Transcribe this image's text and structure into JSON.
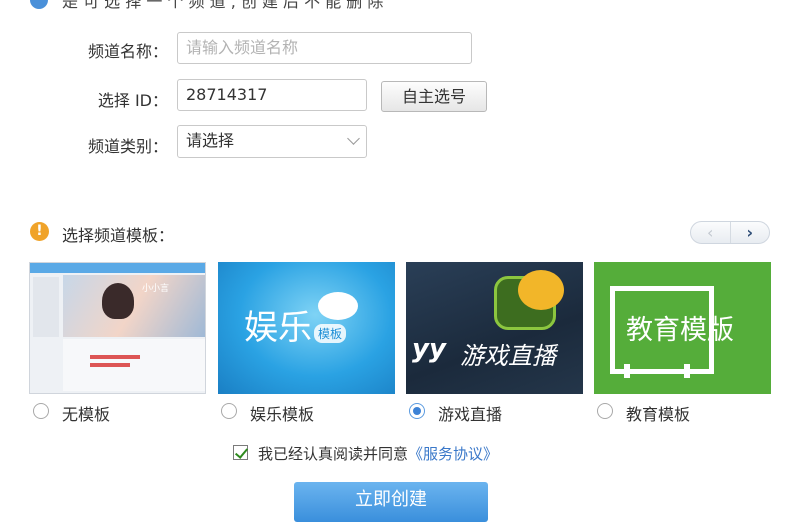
{
  "header": {
    "text": "是 可 选 择 一 个 频 道 , 创 建 后 不 能 删 除"
  },
  "form": {
    "name_label": "频道名称：",
    "name_placeholder": "请输入频道名称",
    "id_label": "选择 ID：",
    "id_value": "28714317",
    "self_select_button": "自主选号",
    "category_label": "频道类别：",
    "category_value": "请选择"
  },
  "templates": {
    "title": "选择频道模板：",
    "pager_prev": "‹",
    "pager_next": "›",
    "items": [
      {
        "label": "无模板",
        "selected": false,
        "thumb_text": "小小言"
      },
      {
        "label": "娱乐模板",
        "selected": false,
        "thumb_text": "娱乐",
        "thumb_sub": "模板"
      },
      {
        "label": "游戏直播",
        "selected": true,
        "thumb_text": "游戏直播",
        "thumb_brand": "yy"
      },
      {
        "label": "教育模板",
        "selected": false,
        "thumb_text": "教育模版"
      }
    ]
  },
  "agreement": {
    "text": "我已经认真阅读并同意",
    "link": "《服务协议》",
    "checked": true
  },
  "submit_label": "立即创建",
  "colors": {
    "accent_blue": "#3c82d6",
    "warning_orange": "#f0a329",
    "education_green": "#55ad3a",
    "link_blue": "#3a78c9"
  }
}
